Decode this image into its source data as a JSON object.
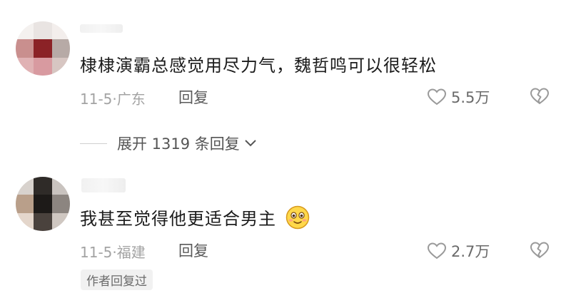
{
  "comments": [
    {
      "text": "棣棣演霸总感觉用尽力气，魏哲鸣可以很轻松",
      "meta": "11-5·广东",
      "reply_label": "回复",
      "likes": "5.5万",
      "icons": {
        "like": "heart-outline-icon",
        "dislike": "broken-heart-icon"
      }
    },
    {
      "text": "我甚至觉得他更适合男主",
      "meta": "11-5·福建",
      "reply_label": "回复",
      "likes": "2.7万",
      "emoji": "smiling-face-emoji",
      "badge": "作者回复过",
      "icons": {
        "like": "heart-outline-icon",
        "dislike": "broken-heart-icon"
      }
    }
  ],
  "expand_replies": {
    "label": "展开 1319 条回复",
    "icon": "chevron-down-icon"
  },
  "colors": {
    "text_primary": "#1c1c1c",
    "text_meta": "#a3a3a3",
    "text_secondary": "#5a5a5a",
    "badge_bg": "#f1f1f1",
    "emoji_face": "#ffd84a"
  }
}
